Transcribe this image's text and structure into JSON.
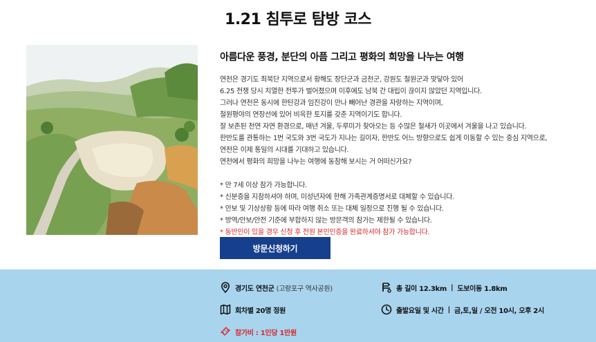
{
  "page": {
    "title": "1.21 침투로 탐방 코스"
  },
  "intro": {
    "subtitle": "아름다운 풍경, 분단의 아픔 그리고 평화의 희망을 나누는 여행",
    "paragraphs": [
      "연천은 경기도 최북단 지역으로서 황해도 장단군과 금천군, 강원도 철원군과 맞닿아 있어",
      "6.25 전쟁 당시 치열한 전투가 벌어졌으며 이후에도 남북 간 대립이 끊이지 않았던 지역입니다.",
      "그러나 연천은 동시에 한탄강과 임진강이 만나 빼어난 경관을 자랑하는 지역이며,",
      "철원평야의 연장선에 있어 비옥한 토지를 갖춘 지역이기도 합니다.",
      "잘 보존된 천연 자연 환경으로, 매년 겨울, 두루미가 찾아오는 등 수많은 철새가 이곳에서 겨울을 나고 있습니다.",
      "한반도를 관통하는 1번 국도와 3번 국도가 지나는 길이자, 한반도 어느 방향으로도 쉽게 이동할 수 있는 중심 지역으로,",
      "연천은 이제 통일의 시대를 기대하고 있습니다.",
      "연천에서 평화의 희망을 나누는 여행에 동참해 보시는 거 어떠신가요?"
    ]
  },
  "notes": {
    "items": [
      "* 만 7세 이상 참가 가능합니다.",
      "* 신분증을 지참하셔야 하며, 미성년자에 한해 가족관계증명서로 대체할 수 있습니다.",
      "* 안보 및 기상상황 등에 따라 여행 취소 또는 대체 일정으로 진행 될 수 있습니다.",
      "* 방역/안보/안전 기준에 부합하지 않는 방문객의 참가는 제한될 수 있습니다."
    ],
    "warning": "* 동반인이 있을 경우 신청 후 전원 본인인증을 완료하셔야 참가 가능합니다."
  },
  "apply": {
    "label": "방문신청하기"
  },
  "info": {
    "location_main": "경기도 연천군",
    "location_sub": "(고랑포구 역사공원)",
    "distance_total": "총 길이 12.3km",
    "distance_walk": "도보이동 1.8km",
    "capacity": "회차별 20명 정원",
    "schedule_label": "출발요일 및 시간",
    "schedule_value": "금,토,일 / 오전 10시, 오후 2시",
    "fee": "참가비 : 1인당 1만원"
  },
  "colors": {
    "button_bg": "#163f8e",
    "band_bg": "#a8d4ee",
    "warning": "#d9262b"
  },
  "icons": [
    "location-pin-icon",
    "route-icon",
    "map-icon",
    "clock-icon",
    "ticket-icon"
  ]
}
